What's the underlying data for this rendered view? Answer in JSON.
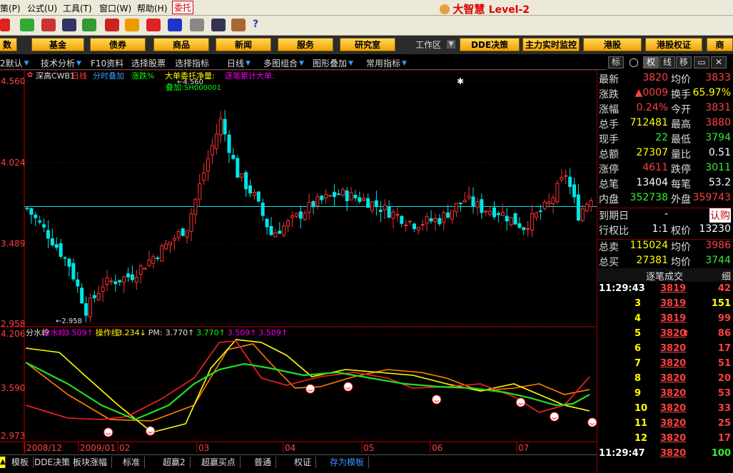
{
  "menu": {
    "items": [
      "策(P)",
      "公式(U)",
      "工具(T)",
      "窗口(W)",
      "帮助(H)",
      "委托"
    ]
  },
  "brand": {
    "name": "大智慧",
    "level": "Level-2"
  },
  "nav": {
    "buttons": [
      "数",
      "基金",
      "债券",
      "商品",
      "新闻",
      "服务",
      "研究室"
    ],
    "workarea": "工作区",
    "right_buttons": [
      "DDE决策",
      "主力实时监控",
      "港股",
      "港股权证",
      "商"
    ]
  },
  "subbar": {
    "items": [
      "2默认",
      "技术分析",
      "F10资料",
      "选择股票",
      "选择指标",
      "日线",
      "多图组合",
      "图形叠加",
      "常用指标"
    ]
  },
  "right_tabs": [
    "标",
    "权",
    "线",
    "移"
  ],
  "chart": {
    "header": {
      "stock": "深高CWB1",
      "period": "日线",
      "overlay": "分时叠加",
      "change": "涨跌%",
      "ind1": "大单委托净量:",
      "ind2": "逐笔累计大单:",
      "overlay2": "叠加:",
      "overlay2_val": "SH000001"
    },
    "price_axis": [
      "4.560",
      "4.024",
      "3.489",
      "2.958"
    ],
    "high_label": "4.560",
    "low_label": "2.958",
    "ind_header": {
      "name": "分水岭",
      "label1": "分水岭:",
      "val1": "3.509↑",
      "label2": "操作线:",
      "val2": "3.234↓",
      "label3": "PM:",
      "val3": "3.770↑",
      "val4": "3.770↑",
      "val5": "3.509↑",
      "val6": "3.509↑"
    },
    "ind_axis": [
      "4.206",
      "3.590",
      "2.973"
    ],
    "dates": [
      "2008/12",
      "2009/01",
      "02",
      "03",
      "04",
      "05",
      "06",
      "07"
    ],
    "ref_line_price": 3.733
  },
  "bottom_tabs": [
    "模板",
    "DDE决策",
    "板块涨幅",
    "标准",
    "超赢2",
    "超赢买点",
    "普通",
    "权证",
    "存为模板"
  ],
  "quote": {
    "rows": [
      {
        "l": "最新",
        "v": "3820",
        "vc": "red",
        "l2": "均价",
        "v2": "3833",
        "v2c": "red"
      },
      {
        "l": "涨跌",
        "v": "▲0009",
        "vc": "red",
        "l2": "换手",
        "v2": "65.97%",
        "v2c": "yel"
      },
      {
        "l": "涨幅",
        "v": "0.24%",
        "vc": "red",
        "l2": "今开",
        "v2": "3831",
        "v2c": "red"
      },
      {
        "l": "总手",
        "v": "712481",
        "vc": "yel",
        "l2": "最高",
        "v2": "3880",
        "v2c": "red"
      },
      {
        "l": "现手",
        "v": "22",
        "vc": "grn",
        "l2": "最低",
        "v2": "3794",
        "v2c": "grn"
      },
      {
        "l": "总额",
        "v": "27307",
        "vc": "yel",
        "l2": "量比",
        "v2": "0.51",
        "v2c": "wht"
      },
      {
        "l": "涨停",
        "v": "4611",
        "vc": "red",
        "l2": "跌停",
        "v2": "3011",
        "v2c": "grn"
      },
      {
        "l": "总笔",
        "v": "13404",
        "vc": "wht",
        "l2": "每笔",
        "v2": "53.2",
        "v2c": "wht"
      },
      {
        "l": "内盘",
        "v": "352738",
        "vc": "grn",
        "l2": "外盘",
        "v2": "359743",
        "v2c": "red"
      },
      {
        "l": "到期日",
        "v": "-",
        "vc": "wht",
        "l2": "",
        "v2": "认购",
        "v2c": "red"
      },
      {
        "l": "行权比",
        "v": "1:1",
        "vc": "wht",
        "l2": "权价",
        "v2": "13230",
        "v2c": "wht"
      },
      {
        "l": "总卖",
        "v": "115024",
        "vc": "yel",
        "l2": "均价",
        "v2": "3986",
        "v2c": "red"
      },
      {
        "l": "总买",
        "v": "27381",
        "vc": "yel",
        "l2": "均价",
        "v2": "3744",
        "v2c": "grn"
      }
    ],
    "tick_header": "逐笔成交",
    "tick_detail": "细",
    "ticks": [
      {
        "t": "11:29:43",
        "p": "3819",
        "q": "42",
        "qc": "red",
        "up": false
      },
      {
        "t": "3",
        "p": "3819",
        "q": "151",
        "qc": "yel",
        "up": false
      },
      {
        "t": "4",
        "p": "3819",
        "q": "99",
        "qc": "red",
        "up": false
      },
      {
        "t": "5",
        "p": "3820",
        "q": "86",
        "qc": "red",
        "up": true
      },
      {
        "t": "6",
        "p": "3820",
        "q": "17",
        "qc": "red",
        "up": false
      },
      {
        "t": "7",
        "p": "3820",
        "q": "51",
        "qc": "red",
        "up": false
      },
      {
        "t": "8",
        "p": "3820",
        "q": "20",
        "qc": "red",
        "up": false
      },
      {
        "t": "9",
        "p": "3820",
        "q": "53",
        "qc": "red",
        "up": false
      },
      {
        "t": "10",
        "p": "3820",
        "q": "33",
        "qc": "red",
        "up": false
      },
      {
        "t": "11",
        "p": "3820",
        "q": "25",
        "qc": "red",
        "up": false
      },
      {
        "t": "12",
        "p": "3820",
        "q": "17",
        "qc": "red",
        "up": false
      },
      {
        "t": "11:29:47",
        "p": "3820",
        "q": "100",
        "qc": "grn",
        "up": false
      }
    ]
  }
}
